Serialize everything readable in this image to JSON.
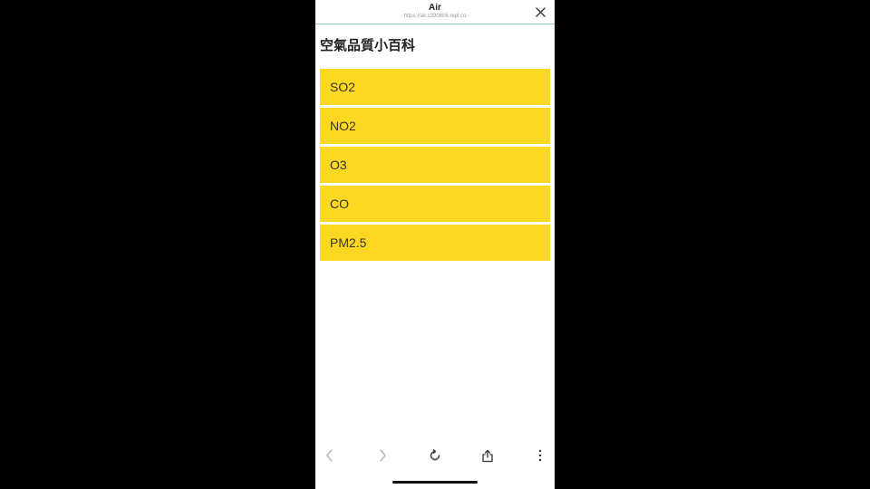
{
  "browser": {
    "title": "Air",
    "url": "https://air.s390806.repl.co"
  },
  "page": {
    "title": "空氣品質小百科"
  },
  "items": [
    {
      "label": "SO2"
    },
    {
      "label": "NO2"
    },
    {
      "label": "O3"
    },
    {
      "label": "CO"
    },
    {
      "label": "PM2.5"
    }
  ],
  "colors": {
    "item_background": "#fcd823",
    "topbar_border": "#8fd3c3",
    "icon_active": "#333333",
    "icon_disabled": "#b5b5b5"
  },
  "icons": {
    "close": "close-icon",
    "back": "chevron-left-icon",
    "forward": "chevron-right-icon",
    "reload": "reload-icon",
    "share": "share-icon",
    "more": "more-vertical-icon"
  }
}
